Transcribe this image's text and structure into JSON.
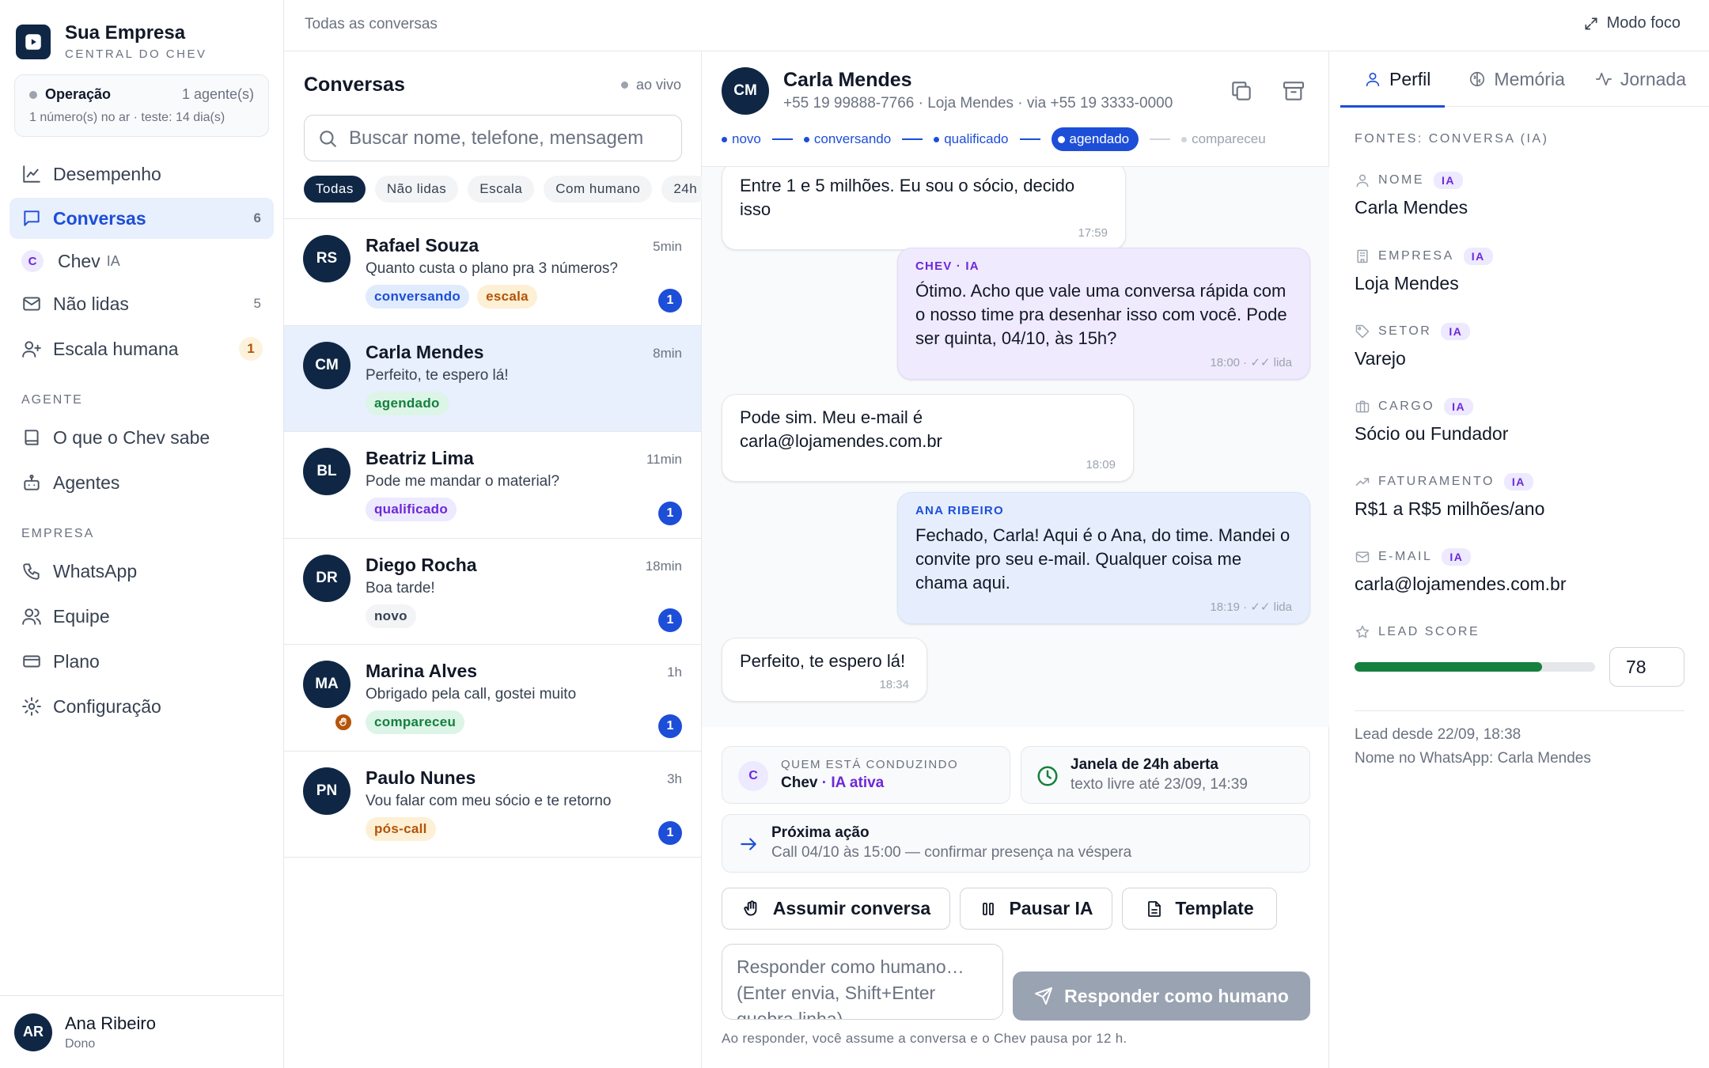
{
  "brand": {
    "name": "Sua Empresa",
    "subtitle": "CENTRAL DO CHEV"
  },
  "operation": {
    "label": "Operação",
    "agents": "1 agente(s)",
    "detail": "1 número(s) no ar · teste: 14 dia(s)"
  },
  "nav": {
    "desempenho": "Desempenho",
    "conversas": "Conversas",
    "conversas_count": "6",
    "chev": "Chev",
    "chev_ia": "IA",
    "chev_avatar": "C",
    "nao_lidas": "Não lidas",
    "nao_lidas_count": "5",
    "escala": "Escala humana",
    "escala_count": "1",
    "agente_section": "AGENTE",
    "o_que_sabe": "O que o Chev sabe",
    "agentes": "Agentes",
    "empresa_section": "EMPRESA",
    "whatsapp": "WhatsApp",
    "equipe": "Equipe",
    "plano": "Plano",
    "config": "Configuração"
  },
  "user": {
    "initials": "AR",
    "name": "Ana Ribeiro",
    "role": "Dono"
  },
  "topbar": {
    "title": "Todas as conversas",
    "focus": "Modo foco"
  },
  "convlist": {
    "title": "Conversas",
    "live": "ao vivo",
    "search_placeholder": "Buscar nome, telefone, mensagem",
    "filters": [
      "Todas",
      "Não lidas",
      "Escala",
      "Com humano",
      "24h"
    ],
    "rows": [
      {
        "initials": "RS",
        "name": "Rafael Souza",
        "time": "5min",
        "preview": "Quanto custa o plano pra 3 números?",
        "tags": [
          {
            "label": "conversando",
            "tone": "blue"
          },
          {
            "label": "escala",
            "tone": "amber"
          }
        ],
        "unread": "1"
      },
      {
        "initials": "CM",
        "name": "Carla Mendes",
        "time": "8min",
        "preview": "Perfeito, te espero lá!",
        "tags": [
          {
            "label": "agendado",
            "tone": "green"
          }
        ],
        "unread": ""
      },
      {
        "initials": "BL",
        "name": "Beatriz Lima",
        "time": "11min",
        "preview": "Pode me mandar o material?",
        "tags": [
          {
            "label": "qualificado",
            "tone": "purple"
          }
        ],
        "unread": "1"
      },
      {
        "initials": "DR",
        "name": "Diego Rocha",
        "time": "18min",
        "preview": "Boa tarde!",
        "tags": [
          {
            "label": "novo",
            "tone": "gray"
          }
        ],
        "unread": "1"
      },
      {
        "initials": "MA",
        "name": "Marina Alves",
        "time": "1h",
        "preview": "Obrigado pela call, gostei muito",
        "tags": [
          {
            "label": "compareceu",
            "tone": "green"
          }
        ],
        "unread": "1"
      },
      {
        "initials": "PN",
        "name": "Paulo Nunes",
        "time": "3h",
        "preview": "Vou falar com meu sócio e te retorno",
        "tags": [
          {
            "label": "pós-call",
            "tone": "amber"
          }
        ],
        "unread": "1"
      }
    ]
  },
  "chat": {
    "initials": "CM",
    "name": "Carla Mendes",
    "sub": "+55 19 99888-7766 · Loja Mendes · via +55 19 3333-0000",
    "stages": [
      "novo",
      "conversando",
      "qualificado",
      "agendado",
      "compareceu"
    ],
    "messages": [
      {
        "dir": "in",
        "text": "Entre 1 e 5 milhões. Eu sou o sócio, decido isso",
        "time": "17:59"
      },
      {
        "dir": "out-ai",
        "sender": "CHEV · IA",
        "text": "Ótimo. Acho que vale uma conversa rápida com o nosso time pra desenhar isso com você. Pode ser quinta, 04/10, às 15h?",
        "time": "18:00 · ✓✓ lida"
      },
      {
        "dir": "in",
        "text": "Pode sim. Meu e-mail é carla@lojamendes.com.br",
        "time": "18:09"
      },
      {
        "dir": "out-human",
        "sender": "ANA RIBEIRO",
        "text": "Fechado, Carla! Aqui é o Ana, do time. Mandei o convite pro seu e-mail. Qualquer coisa me chama aqui.",
        "time": "18:19 · ✓✓ lida"
      },
      {
        "dir": "in",
        "text": "Perfeito, te espero lá!",
        "time": "18:34"
      }
    ],
    "conducting": {
      "label": "QUEM ESTÁ CONDUZINDO",
      "who": "Chev",
      "status": "· IA ativa",
      "avatar": "C"
    },
    "window": {
      "title": "Janela de 24h aberta",
      "sub": "texto livre até 23/09, 14:39"
    },
    "next_action": {
      "title": "Próxima ação",
      "sub": "Call 04/10 às 15:00 — confirmar presença na véspera"
    },
    "buttons": {
      "assume": "Assumir conversa",
      "pause": "Pausar IA",
      "template": "Template"
    },
    "reply_placeholder": "Responder como humano… (Enter envia, Shift+Enter quebra linha)",
    "send": "Responder como humano",
    "note": "Ao responder, você assume a conversa e o Chev pausa por 12 h."
  },
  "profile": {
    "tabs": [
      "Perfil",
      "Memória",
      "Jornada"
    ],
    "sources": "FONTES: CONVERSA (IA)",
    "ia_pill": "IA",
    "fields": [
      {
        "label": "NOME",
        "value": "Carla Mendes",
        "icon": "user-icon"
      },
      {
        "label": "EMPRESA",
        "value": "Loja Mendes",
        "icon": "building-icon"
      },
      {
        "label": "SETOR",
        "value": "Varejo",
        "icon": "tag-icon"
      },
      {
        "label": "CARGO",
        "value": "Sócio ou Fundador",
        "icon": "briefcase-icon"
      },
      {
        "label": "FATURAMENTO",
        "value": "R$1 a R$5 milhões/ano",
        "icon": "trend-icon"
      },
      {
        "label": "E-MAIL",
        "value": "carla@lojamendes.com.br",
        "icon": "mail-icon"
      }
    ],
    "lead_score_label": "LEAD SCORE",
    "lead_score": "78",
    "lead_since": "Lead desde 22/09, 18:38",
    "whatsapp_name": "Nome no WhatsApp: Carla Mendes"
  },
  "colors": {
    "navy": "#0f2745",
    "accent": "#1d4ed8",
    "ai_purple": "#6d28d9",
    "success": "#15803d"
  }
}
